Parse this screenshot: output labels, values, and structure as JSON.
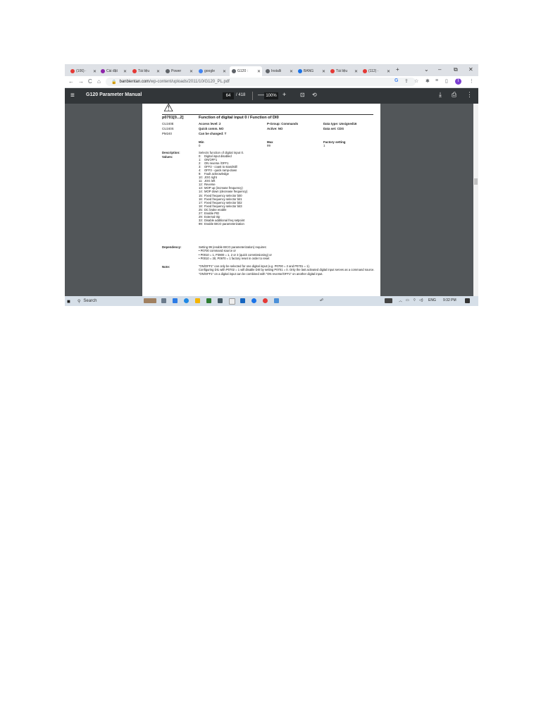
{
  "browser": {
    "tabs": [
      {
        "label": "(106) ·",
        "color": "#e53935"
      },
      {
        "label": "Cài đặt",
        "color": "#8e24aa"
      },
      {
        "label": "Tài liệu",
        "color": "#e53935"
      },
      {
        "label": "Power",
        "color": "#5f6368"
      },
      {
        "label": "google",
        "color": "#4285f4"
      },
      {
        "label": "G120 :",
        "color": "#5f6368",
        "active": true
      },
      {
        "label": "Installi",
        "color": "#5f6368"
      },
      {
        "label": "BẢNG",
        "color": "#1a73e8"
      },
      {
        "label": "Tài liệu",
        "color": "#e53935"
      },
      {
        "label": "(112) ·",
        "color": "#e53935"
      }
    ],
    "new_tab": "+",
    "window_controls": {
      "menu": "⌄",
      "minimize": "–",
      "restore": "⧉",
      "close": "✕"
    },
    "nav": {
      "back": "←",
      "forward": "→",
      "reload": "C",
      "home": "⌂"
    },
    "url_host": "banbientan.com",
    "url_path": "/wp-content/uploads/2011/10/G120_PL.pdf",
    "profile_initial": "T"
  },
  "pdf_toolbar": {
    "menu_icon": "≡",
    "title": "G120 Parameter Manual",
    "page_current": "64",
    "page_total": "/ 418",
    "zoom_out": "—",
    "zoom": "100%",
    "zoom_in": "+"
  },
  "page": {
    "param_id": "p0701[0...2]",
    "param_title": "Function of digital input 0 / Function of DI0",
    "units": [
      "CU240E",
      "CU240S",
      "PM240"
    ],
    "access_level": "Access level: 2",
    "quick_comm": "Quick comm. NO",
    "can_change": "Can be changed: T",
    "p_group": "P-Group: Commands",
    "active": "Active: NO",
    "data_type": "Data type: Unsigned16",
    "data_set": "Data set: CDS",
    "min_label": "Min",
    "min_value": "0",
    "max_label": "Max",
    "max_value": "99",
    "factory_label": "Factory setting",
    "factory_value": "1",
    "description_label": "Description:",
    "description_text": "Selects function of digital input 0.",
    "values_label": "Values:",
    "values": [
      {
        "n": "0:",
        "t": "Digital input disabled"
      },
      {
        "n": "1:",
        "t": "ON/OFF1"
      },
      {
        "n": "2:",
        "t": "ON reverse /OFF1"
      },
      {
        "n": "3:",
        "t": "OFF2    - coast to standstill"
      },
      {
        "n": "4:",
        "t": "OFF3    - quick ramp-down"
      },
      {
        "n": "9:",
        "t": "Fault acknowledge"
      },
      {
        "n": "10:",
        "t": "JOG right"
      },
      {
        "n": "11:",
        "t": "JOG left"
      },
      {
        "n": "12:",
        "t": "Reverse"
      },
      {
        "n": "13:",
        "t": "MOP up   (increase frequency)"
      },
      {
        "n": "14:",
        "t": "MOP down (decrease frequency)"
      },
      {
        "n": "15:",
        "t": "Fixed frequency selector bit0"
      },
      {
        "n": "16:",
        "t": "Fixed frequency selector bit1"
      },
      {
        "n": "17:",
        "t": "Fixed frequency selector bit2"
      },
      {
        "n": "18:",
        "t": "Fixed frequency selector bit3"
      },
      {
        "n": "25:",
        "t": "DC brake enable"
      },
      {
        "n": "27:",
        "t": "Enable PID"
      },
      {
        "n": "29:",
        "t": "External trip"
      },
      {
        "n": "33:",
        "t": "Disable additional freq setpoint"
      },
      {
        "n": "99:",
        "t": "Enable BICO parameterization"
      }
    ],
    "dependency_label": "Dependency:",
    "dependency_lines": [
      "Setting 99 (enable BICO parameterization) requires:",
      "•    P0700 command source or",
      "•    P0010 = 1, P3900 = 1, 2 or 3 (quick commissioning) or",
      "•    P0010 = 30, P0970 = 1 factory reset in order to reset"
    ],
    "note_label": "Note:",
    "note_lines": [
      "\"ON/OFF1\" can only be selected for one digital input (e.g. P0700 = 2 and P0701 = 1).",
      "Configuring DI1 with P0702 = 1 will disable DI0 by setting P0701 = 0. Only the last activated digital input serves as a command source.",
      "\"ON/OFF1\" on a digital input can be combined with \"ON reverse/OFF1\" on another digital input."
    ]
  },
  "taskbar": {
    "search": "Search",
    "lang": "ENG",
    "time": "9:32 PM"
  }
}
